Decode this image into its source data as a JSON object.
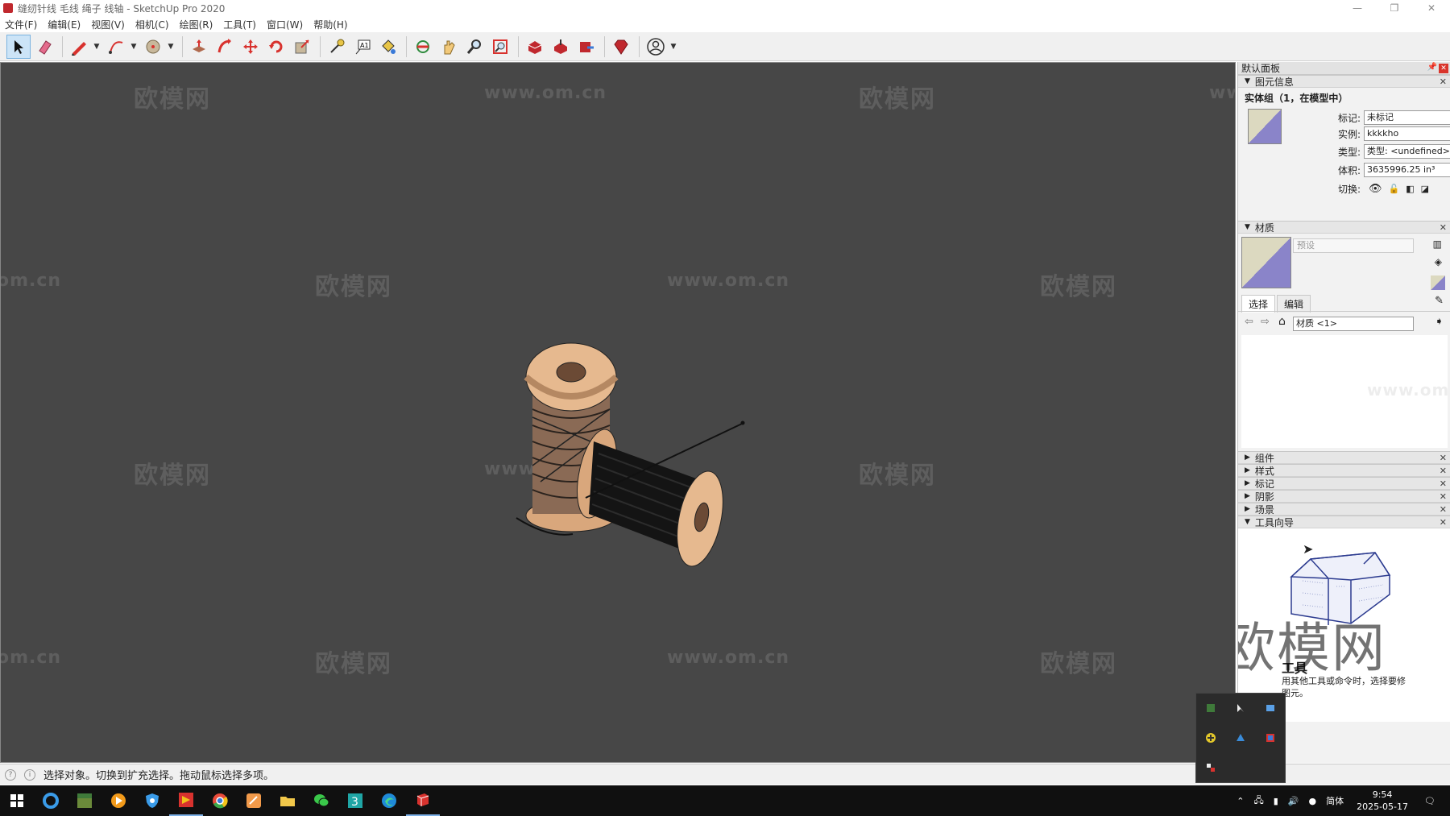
{
  "window": {
    "title": "缝纫针线 毛线 绳子 线轴 - SketchUp Pro 2020",
    "minimize": "—",
    "maximize": "❐",
    "close": "✕"
  },
  "menu": [
    "文件(F)",
    "编辑(E)",
    "视图(V)",
    "相机(C)",
    "绘图(R)",
    "工具(T)",
    "窗口(W)",
    "帮助(H)"
  ],
  "watermarks": {
    "brand": "欧模网",
    "url": "www.om.cn",
    "url_partial": "om.cn",
    "url_right": "www.om.cn"
  },
  "panel": {
    "title": "默认面板",
    "entity_info": {
      "header": "图元信息",
      "title": "实体组（1，在模型中）",
      "tag_label": "标记:",
      "tag_value": "未标记",
      "instance_label": "实例:",
      "instance_value": "kkkkho",
      "type_label": "类型:",
      "type_value": "类型:  <undefined>",
      "volume_label": "体积:",
      "volume_value": "3635996.25 in³",
      "toggle_label": "切换:"
    },
    "materials": {
      "header": "材质",
      "preset_placeholder": "预设",
      "tab_select": "选择",
      "tab_edit": "编辑",
      "collection": "材质 <1>"
    },
    "collapsed_sections": [
      "组件",
      "样式",
      "标记",
      "阴影",
      "场景"
    ],
    "instructor": {
      "header": "工具向导",
      "tool_name": "工具",
      "desc_line1": "用其他工具或命令时，选择要修",
      "desc_line2": "图元。"
    }
  },
  "status": {
    "message": "选择对象。切换到扩充选择。拖动鼠标选择多项。"
  },
  "taskbar": {
    "ime": "简体",
    "time": "9:54",
    "date": "2025-05-17"
  },
  "colors": {
    "viewport": "#474747",
    "spool_wood": "#e6b98f",
    "material_swatch": "#8a84c9"
  }
}
